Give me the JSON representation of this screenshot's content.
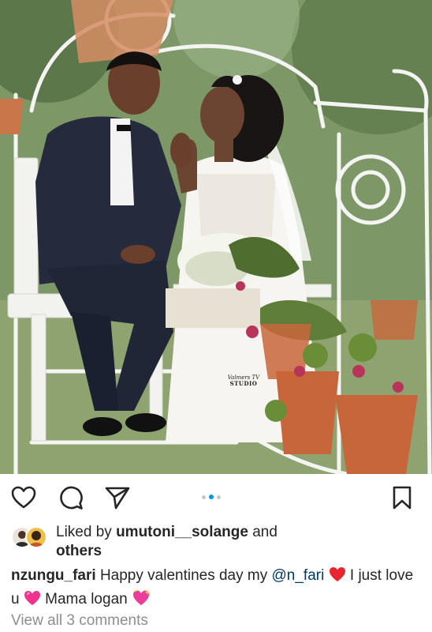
{
  "post": {
    "image": {
      "watermark_line1": "Valmers TV",
      "watermark_line2": "STUDIO"
    },
    "carousel": {
      "count": 3,
      "active_index": 1
    },
    "actions": {
      "like_icon": "heart-outline-icon",
      "comment_icon": "comment-bubble-icon",
      "share_icon": "paper-plane-icon",
      "save_icon": "bookmark-icon"
    },
    "likes": {
      "prefix": "Liked by",
      "user": "umutoni__solange",
      "conjunction": "and",
      "suffix": "others"
    },
    "caption": {
      "username": "nzungu_fari",
      "text1": "Happy valentines day my",
      "mention": "@n_fari",
      "emoji1": "red-heart-icon",
      "text2": "I just love u",
      "emoji2": "pink-heart-icon",
      "text3": "Mama logan",
      "emoji3": "sparkling-heart-icon"
    },
    "comments_link": "View all 3 comments"
  },
  "colors": {
    "text": "#262626",
    "muted": "#8e8e8e",
    "mention": "#00376b",
    "carousel_active": "#0095f6",
    "carousel_inactive": "#c7c7c7",
    "red_heart": "#e8262f",
    "pink_heart": "#f0328f"
  }
}
